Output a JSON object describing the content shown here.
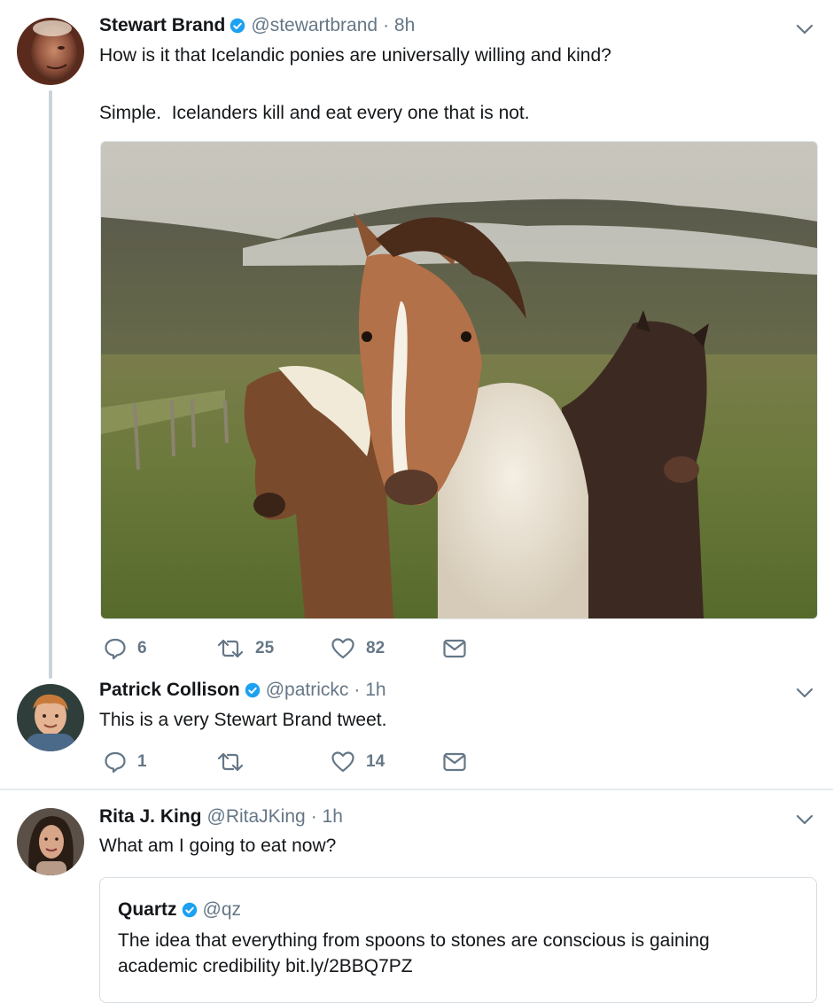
{
  "tweets": [
    {
      "author_name": "Stewart Brand",
      "handle": "@stewartbrand",
      "time": "· 8h",
      "text_line1": "How is it that Icelandic ponies are universally willing and kind?",
      "text_line2": "Simple.  Icelanders kill and eat every one that is not.",
      "replies": "6",
      "retweets": "25",
      "likes": "82"
    },
    {
      "author_name": "Patrick Collison",
      "handle": "@patrickc",
      "time": "· 1h",
      "text": "This is a very Stewart Brand tweet.",
      "replies": "1",
      "retweets": "",
      "likes": "14"
    },
    {
      "author_name": "Rita J. King",
      "handle": "@RitaJKing",
      "time": "· 1h",
      "text": "What am I going to eat now?"
    }
  ],
  "quoted": {
    "author_name": "Quartz",
    "handle": "@qz",
    "text_line1": "The idea that everything from spoons to stones are conscious is gaining",
    "text_line2": "academic credibility bit.ly/2BBQ7PZ"
  },
  "icons": {
    "reply": "speech-bubble-icon",
    "retweet": "retweet-arrows-icon",
    "like": "heart-icon",
    "dm": "envelope-icon",
    "verified": "verified-badge-icon",
    "caret": "chevron-down-icon"
  },
  "colors": {
    "verified": "#1da1f2",
    "text_secondary": "#657786",
    "thread_line": "#cad3da"
  }
}
